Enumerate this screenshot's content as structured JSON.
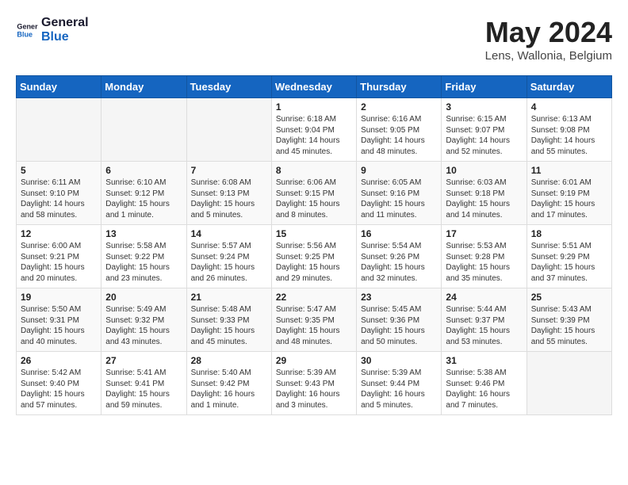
{
  "logo": {
    "line1": "General",
    "line2": "Blue"
  },
  "title": "May 2024",
  "location": "Lens, Wallonia, Belgium",
  "days_header": [
    "Sunday",
    "Monday",
    "Tuesday",
    "Wednesday",
    "Thursday",
    "Friday",
    "Saturday"
  ],
  "weeks": [
    [
      {
        "day": "",
        "sunrise": "",
        "sunset": "",
        "daylight": ""
      },
      {
        "day": "",
        "sunrise": "",
        "sunset": "",
        "daylight": ""
      },
      {
        "day": "",
        "sunrise": "",
        "sunset": "",
        "daylight": ""
      },
      {
        "day": "1",
        "sunrise": "Sunrise: 6:18 AM",
        "sunset": "Sunset: 9:04 PM",
        "daylight": "Daylight: 14 hours and 45 minutes."
      },
      {
        "day": "2",
        "sunrise": "Sunrise: 6:16 AM",
        "sunset": "Sunset: 9:05 PM",
        "daylight": "Daylight: 14 hours and 48 minutes."
      },
      {
        "day": "3",
        "sunrise": "Sunrise: 6:15 AM",
        "sunset": "Sunset: 9:07 PM",
        "daylight": "Daylight: 14 hours and 52 minutes."
      },
      {
        "day": "4",
        "sunrise": "Sunrise: 6:13 AM",
        "sunset": "Sunset: 9:08 PM",
        "daylight": "Daylight: 14 hours and 55 minutes."
      }
    ],
    [
      {
        "day": "5",
        "sunrise": "Sunrise: 6:11 AM",
        "sunset": "Sunset: 9:10 PM",
        "daylight": "Daylight: 14 hours and 58 minutes."
      },
      {
        "day": "6",
        "sunrise": "Sunrise: 6:10 AM",
        "sunset": "Sunset: 9:12 PM",
        "daylight": "Daylight: 15 hours and 1 minute."
      },
      {
        "day": "7",
        "sunrise": "Sunrise: 6:08 AM",
        "sunset": "Sunset: 9:13 PM",
        "daylight": "Daylight: 15 hours and 5 minutes."
      },
      {
        "day": "8",
        "sunrise": "Sunrise: 6:06 AM",
        "sunset": "Sunset: 9:15 PM",
        "daylight": "Daylight: 15 hours and 8 minutes."
      },
      {
        "day": "9",
        "sunrise": "Sunrise: 6:05 AM",
        "sunset": "Sunset: 9:16 PM",
        "daylight": "Daylight: 15 hours and 11 minutes."
      },
      {
        "day": "10",
        "sunrise": "Sunrise: 6:03 AM",
        "sunset": "Sunset: 9:18 PM",
        "daylight": "Daylight: 15 hours and 14 minutes."
      },
      {
        "day": "11",
        "sunrise": "Sunrise: 6:01 AM",
        "sunset": "Sunset: 9:19 PM",
        "daylight": "Daylight: 15 hours and 17 minutes."
      }
    ],
    [
      {
        "day": "12",
        "sunrise": "Sunrise: 6:00 AM",
        "sunset": "Sunset: 9:21 PM",
        "daylight": "Daylight: 15 hours and 20 minutes."
      },
      {
        "day": "13",
        "sunrise": "Sunrise: 5:58 AM",
        "sunset": "Sunset: 9:22 PM",
        "daylight": "Daylight: 15 hours and 23 minutes."
      },
      {
        "day": "14",
        "sunrise": "Sunrise: 5:57 AM",
        "sunset": "Sunset: 9:24 PM",
        "daylight": "Daylight: 15 hours and 26 minutes."
      },
      {
        "day": "15",
        "sunrise": "Sunrise: 5:56 AM",
        "sunset": "Sunset: 9:25 PM",
        "daylight": "Daylight: 15 hours and 29 minutes."
      },
      {
        "day": "16",
        "sunrise": "Sunrise: 5:54 AM",
        "sunset": "Sunset: 9:26 PM",
        "daylight": "Daylight: 15 hours and 32 minutes."
      },
      {
        "day": "17",
        "sunrise": "Sunrise: 5:53 AM",
        "sunset": "Sunset: 9:28 PM",
        "daylight": "Daylight: 15 hours and 35 minutes."
      },
      {
        "day": "18",
        "sunrise": "Sunrise: 5:51 AM",
        "sunset": "Sunset: 9:29 PM",
        "daylight": "Daylight: 15 hours and 37 minutes."
      }
    ],
    [
      {
        "day": "19",
        "sunrise": "Sunrise: 5:50 AM",
        "sunset": "Sunset: 9:31 PM",
        "daylight": "Daylight: 15 hours and 40 minutes."
      },
      {
        "day": "20",
        "sunrise": "Sunrise: 5:49 AM",
        "sunset": "Sunset: 9:32 PM",
        "daylight": "Daylight: 15 hours and 43 minutes."
      },
      {
        "day": "21",
        "sunrise": "Sunrise: 5:48 AM",
        "sunset": "Sunset: 9:33 PM",
        "daylight": "Daylight: 15 hours and 45 minutes."
      },
      {
        "day": "22",
        "sunrise": "Sunrise: 5:47 AM",
        "sunset": "Sunset: 9:35 PM",
        "daylight": "Daylight: 15 hours and 48 minutes."
      },
      {
        "day": "23",
        "sunrise": "Sunrise: 5:45 AM",
        "sunset": "Sunset: 9:36 PM",
        "daylight": "Daylight: 15 hours and 50 minutes."
      },
      {
        "day": "24",
        "sunrise": "Sunrise: 5:44 AM",
        "sunset": "Sunset: 9:37 PM",
        "daylight": "Daylight: 15 hours and 53 minutes."
      },
      {
        "day": "25",
        "sunrise": "Sunrise: 5:43 AM",
        "sunset": "Sunset: 9:39 PM",
        "daylight": "Daylight: 15 hours and 55 minutes."
      }
    ],
    [
      {
        "day": "26",
        "sunrise": "Sunrise: 5:42 AM",
        "sunset": "Sunset: 9:40 PM",
        "daylight": "Daylight: 15 hours and 57 minutes."
      },
      {
        "day": "27",
        "sunrise": "Sunrise: 5:41 AM",
        "sunset": "Sunset: 9:41 PM",
        "daylight": "Daylight: 15 hours and 59 minutes."
      },
      {
        "day": "28",
        "sunrise": "Sunrise: 5:40 AM",
        "sunset": "Sunset: 9:42 PM",
        "daylight": "Daylight: 16 hours and 1 minute."
      },
      {
        "day": "29",
        "sunrise": "Sunrise: 5:39 AM",
        "sunset": "Sunset: 9:43 PM",
        "daylight": "Daylight: 16 hours and 3 minutes."
      },
      {
        "day": "30",
        "sunrise": "Sunrise: 5:39 AM",
        "sunset": "Sunset: 9:44 PM",
        "daylight": "Daylight: 16 hours and 5 minutes."
      },
      {
        "day": "31",
        "sunrise": "Sunrise: 5:38 AM",
        "sunset": "Sunset: 9:46 PM",
        "daylight": "Daylight: 16 hours and 7 minutes."
      },
      {
        "day": "",
        "sunrise": "",
        "sunset": "",
        "daylight": ""
      }
    ]
  ]
}
